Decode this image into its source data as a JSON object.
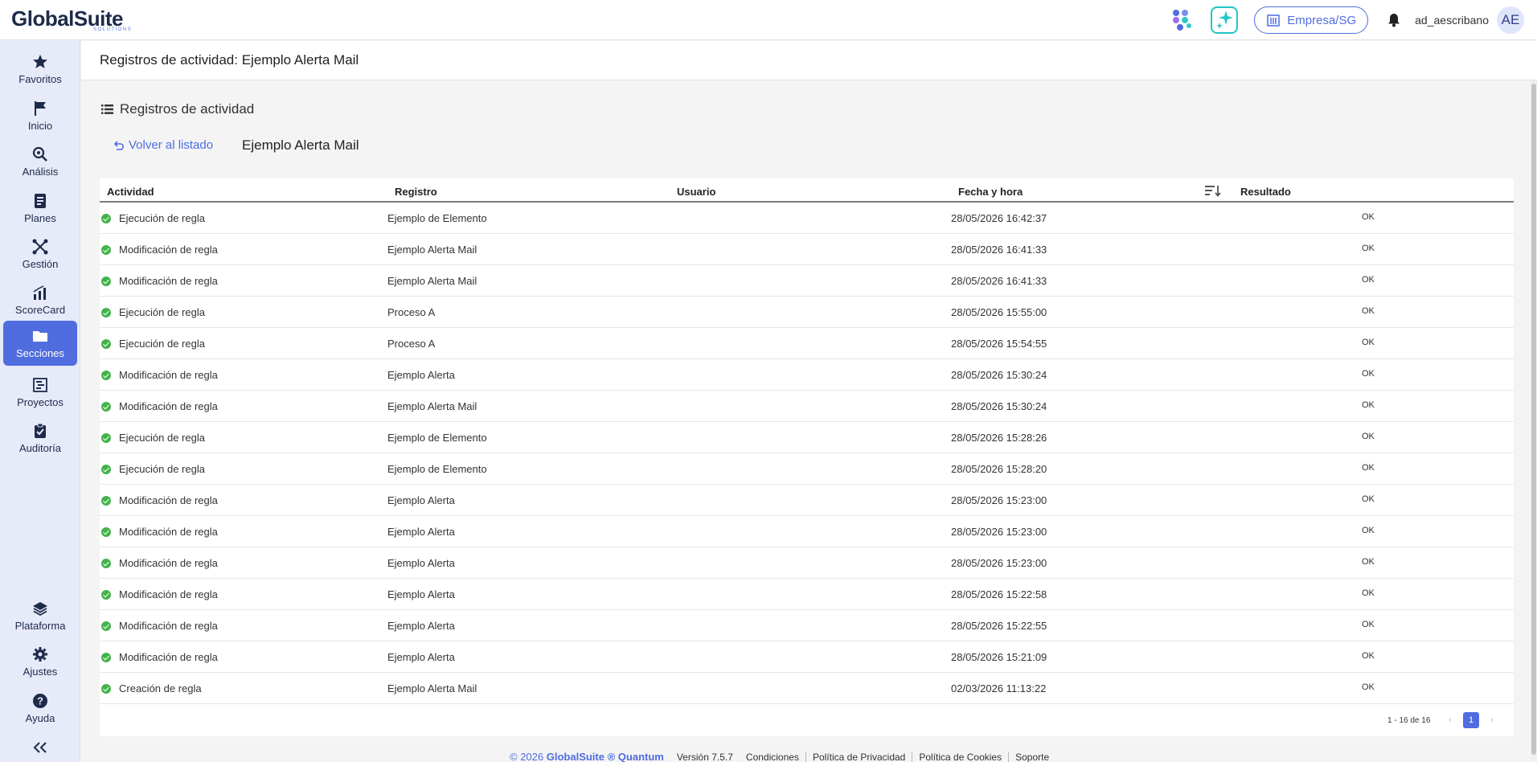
{
  "header": {
    "logo_text": "GlobalSuite",
    "logo_sub": "SOLUTIONS",
    "company_button": "Empresa/SG",
    "username": "ad_aescribano",
    "avatar_initials": "AE"
  },
  "sidebar": {
    "items": [
      {
        "label": "Favoritos",
        "icon": "star-icon"
      },
      {
        "label": "Inicio",
        "icon": "flag-icon"
      },
      {
        "label": "Análisis",
        "icon": "analysis-icon"
      },
      {
        "label": "Planes",
        "icon": "plans-icon"
      },
      {
        "label": "Gestión",
        "icon": "management-icon"
      },
      {
        "label": "ScoreCard",
        "icon": "chart-icon"
      },
      {
        "label": "Secciones",
        "icon": "folder-icon"
      },
      {
        "label": "Proyectos",
        "icon": "projects-icon"
      },
      {
        "label": "Auditoría",
        "icon": "clipboard-icon"
      }
    ],
    "bottom_items": [
      {
        "label": "Plataforma",
        "icon": "layers-icon"
      },
      {
        "label": "Ajustes",
        "icon": "gear-icon"
      },
      {
        "label": "Ayuda",
        "icon": "help-icon"
      }
    ],
    "active": "Secciones"
  },
  "page": {
    "title": "Registros de actividad: Ejemplo Alerta Mail",
    "section_title": "Registros de actividad",
    "back_link": "Volver al listado",
    "record_name": "Ejemplo Alerta Mail"
  },
  "table": {
    "columns": [
      "Actividad",
      "Registro",
      "Usuario",
      "Fecha y hora",
      "Resultado"
    ],
    "rows": [
      {
        "actividad": "Ejecución de regla",
        "registro": "Ejemplo de Elemento",
        "usuario": "",
        "fecha": "28/05/2026 16:42:37",
        "resultado": "OK"
      },
      {
        "actividad": "Modificación de regla",
        "registro": "Ejemplo Alerta Mail",
        "usuario": "",
        "fecha": "28/05/2026 16:41:33",
        "resultado": "OK"
      },
      {
        "actividad": "Modificación de regla",
        "registro": "Ejemplo Alerta Mail",
        "usuario": "",
        "fecha": "28/05/2026 16:41:33",
        "resultado": "OK"
      },
      {
        "actividad": "Ejecución de regla",
        "registro": "Proceso A",
        "usuario": "",
        "fecha": "28/05/2026 15:55:00",
        "resultado": "OK"
      },
      {
        "actividad": "Ejecución de regla",
        "registro": "Proceso A",
        "usuario": "",
        "fecha": "28/05/2026 15:54:55",
        "resultado": "OK"
      },
      {
        "actividad": "Modificación de regla",
        "registro": "Ejemplo Alerta",
        "usuario": "",
        "fecha": "28/05/2026 15:30:24",
        "resultado": "OK"
      },
      {
        "actividad": "Modificación de regla",
        "registro": "Ejemplo Alerta Mail",
        "usuario": "",
        "fecha": "28/05/2026 15:30:24",
        "resultado": "OK"
      },
      {
        "actividad": "Ejecución de regla",
        "registro": "Ejemplo de Elemento",
        "usuario": "",
        "fecha": "28/05/2026 15:28:26",
        "resultado": "OK"
      },
      {
        "actividad": "Ejecución de regla",
        "registro": "Ejemplo de Elemento",
        "usuario": "",
        "fecha": "28/05/2026 15:28:20",
        "resultado": "OK"
      },
      {
        "actividad": "Modificación de regla",
        "registro": "Ejemplo Alerta",
        "usuario": "",
        "fecha": "28/05/2026 15:23:00",
        "resultado": "OK"
      },
      {
        "actividad": "Modificación de regla",
        "registro": "Ejemplo Alerta",
        "usuario": "",
        "fecha": "28/05/2026 15:23:00",
        "resultado": "OK"
      },
      {
        "actividad": "Modificación de regla",
        "registro": "Ejemplo Alerta",
        "usuario": "",
        "fecha": "28/05/2026 15:23:00",
        "resultado": "OK"
      },
      {
        "actividad": "Modificación de regla",
        "registro": "Ejemplo Alerta",
        "usuario": "",
        "fecha": "28/05/2026 15:22:58",
        "resultado": "OK"
      },
      {
        "actividad": "Modificación de regla",
        "registro": "Ejemplo Alerta",
        "usuario": "",
        "fecha": "28/05/2026 15:22:55",
        "resultado": "OK"
      },
      {
        "actividad": "Modificación de regla",
        "registro": "Ejemplo Alerta",
        "usuario": "",
        "fecha": "28/05/2026 15:21:09",
        "resultado": "OK"
      },
      {
        "actividad": "Creación de regla",
        "registro": "Ejemplo Alerta Mail",
        "usuario": "",
        "fecha": "02/03/2026 11:13:22",
        "resultado": "OK"
      }
    ]
  },
  "pagination": {
    "info": "1 - 16 de 16",
    "current_page": "1",
    "prev": "‹",
    "next": "›"
  },
  "footer": {
    "copyright": "© 2026",
    "brand": "GlobalSuite ® Quantum",
    "version": "Versión 7.5.7",
    "links": [
      "Condiciones",
      "Política de Privacidad",
      "Política de Cookies",
      "Soporte"
    ]
  },
  "colors": {
    "accent": "#4f6ddf",
    "sidebar_bg": "#e6eaf9",
    "success": "#43b34a",
    "ai_teal": "#1fc6c6"
  }
}
